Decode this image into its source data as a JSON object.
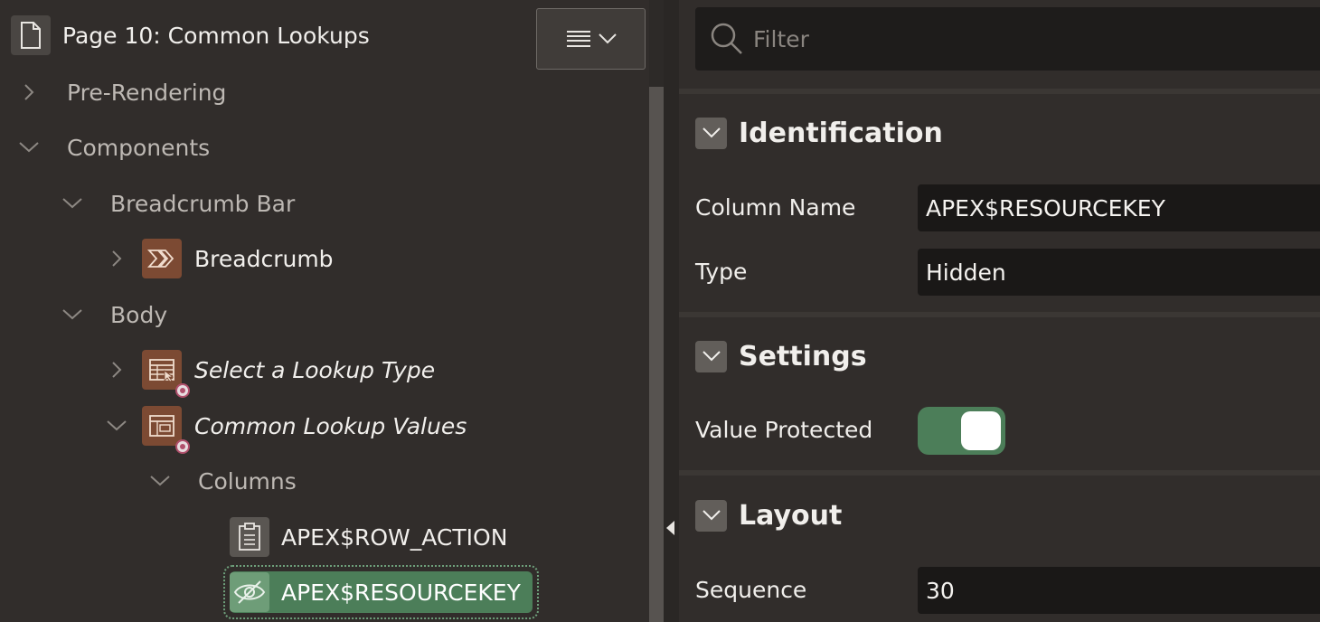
{
  "page_title": "Page 10: Common Lookups",
  "tree": {
    "pre_rendering": "Pre-Rendering",
    "components": "Components",
    "breadcrumb_bar": "Breadcrumb Bar",
    "breadcrumb": "Breadcrumb",
    "body": "Body",
    "select_lookup_type": "Select a Lookup Type",
    "common_lookup_values": "Common Lookup Values",
    "columns": "Columns",
    "row_action": "APEX$ROW_ACTION",
    "resourcekey": "APEX$RESOURCEKEY"
  },
  "filter": {
    "placeholder": "Filter"
  },
  "sections": {
    "identification": {
      "title": "Identification",
      "column_name_label": "Column Name",
      "column_name_value": "APEX$RESOURCEKEY",
      "type_label": "Type",
      "type_value": "Hidden"
    },
    "settings": {
      "title": "Settings",
      "value_protected_label": "Value Protected",
      "value_protected": true
    },
    "layout": {
      "title": "Layout",
      "sequence_label": "Sequence",
      "sequence_value": "30"
    }
  },
  "colors": {
    "accent_green": "#4c7e59",
    "component_brown": "#7c4a33"
  }
}
